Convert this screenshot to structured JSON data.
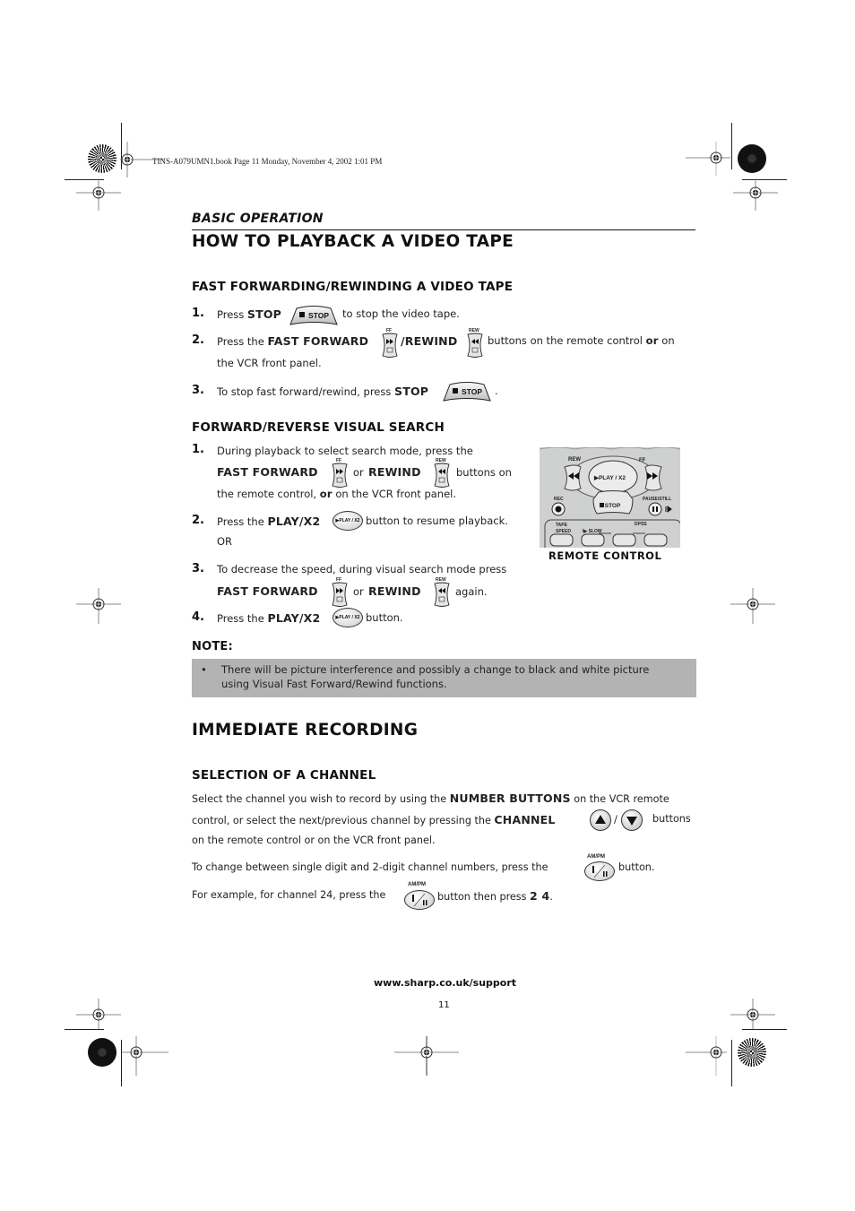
{
  "print_header": {
    "book_info": "TINS-A079UMN1.book  Page 11  Monday, November 4, 2002  1:01 PM"
  },
  "section_kicker": "BASIC OPERATION",
  "playback": {
    "title": "HOW TO PLAYBACK A VIDEO TAPE",
    "ffrew": {
      "heading": "FAST FORWARDING/REWINDING A VIDEO TAPE",
      "steps": [
        {
          "num": "1.",
          "pre": "Press ",
          "bold": "STOP",
          "post": "to stop the video tape."
        },
        {
          "num": "2.",
          "pre": "Press the ",
          "bold1": "FAST FORWARD",
          "bold2": "/REWIND",
          "post": "buttons on the remote control",
          "or": "or",
          "post2": "on",
          "line2": "the VCR front panel."
        },
        {
          "num": "3.",
          "pre": "To stop fast forward/rewind, press ",
          "bold": "STOP",
          "post": "."
        }
      ]
    },
    "search": {
      "heading": "FORWARD/REVERSE VISUAL SEARCH",
      "steps": [
        {
          "num": "1.",
          "line1": "During playback to select search mode,  press the",
          "bold1": "FAST FORWARD",
          "mid": "or",
          "bold2": "REWIND",
          "post": "buttons on",
          "line3a": "the remote control,",
          "or": "or",
          "line3b": "on the VCR front panel."
        },
        {
          "num": "2.",
          "pre": "Press the ",
          "bold": "PLAY/X2",
          "post": "button to resume playback.",
          "line2": "OR"
        },
        {
          "num": "3.",
          "line1": "To decrease the speed, during visual search mode press",
          "bold1": "FAST FORWARD",
          "mid": "or",
          "bold2": "REWIND",
          "post": "again."
        },
        {
          "num": "4.",
          "pre": "Press the ",
          "bold": "PLAY/X2",
          "post": "button."
        }
      ]
    },
    "remote_caption": "REMOTE CONTROL",
    "remote_labels": {
      "rew": "REW",
      "ff": "FF",
      "play": "▶PLAY / X2",
      "rec": "REC",
      "stop": "■ STOP",
      "pause": "PAUSE/STILL",
      "tape_speed": "TAPE SPEED",
      "slow": "I▶ SLOW",
      "dpss": "DPSS"
    },
    "note": {
      "label": "NOTE:",
      "bullet": "•",
      "text_line1": "There will be picture interference and possibly a change to black and white picture",
      "text_line2": "using Visual Fast Forward/Rewind functions."
    }
  },
  "recording": {
    "title": "IMMEDIATE RECORDING",
    "channel": {
      "heading": "SELECTION OF A CHANNEL",
      "p1_pre": "Select the channel you wish to record by using the ",
      "p1_bold": "NUMBER BUTTONS",
      "p1_post": " on the VCR remote",
      "p2_pre": "control, or select the next/previous channel by pressing the ",
      "p2_bold": "CHANNEL",
      "p2_slash": "/",
      "p2_post": "buttons",
      "p3": "on the remote control or on the VCR front panel.",
      "p4_pre": "To change between single digit and 2-digit channel numbers, press the",
      "p4_post": "button.",
      "p5_pre": "For example, for channel 24, press the",
      "p5_mid": "button then press ",
      "p5_bold": "2 4",
      "p5_post": "."
    }
  },
  "icons": {
    "stop_label": "■ STOP",
    "ff_label": "FF",
    "rew_label": "REW",
    "play_label": "▶PLAY / X2",
    "ampm_label": "AM/PM"
  },
  "footer": {
    "url": "www.sharp.co.uk/support",
    "page_number": "11"
  }
}
